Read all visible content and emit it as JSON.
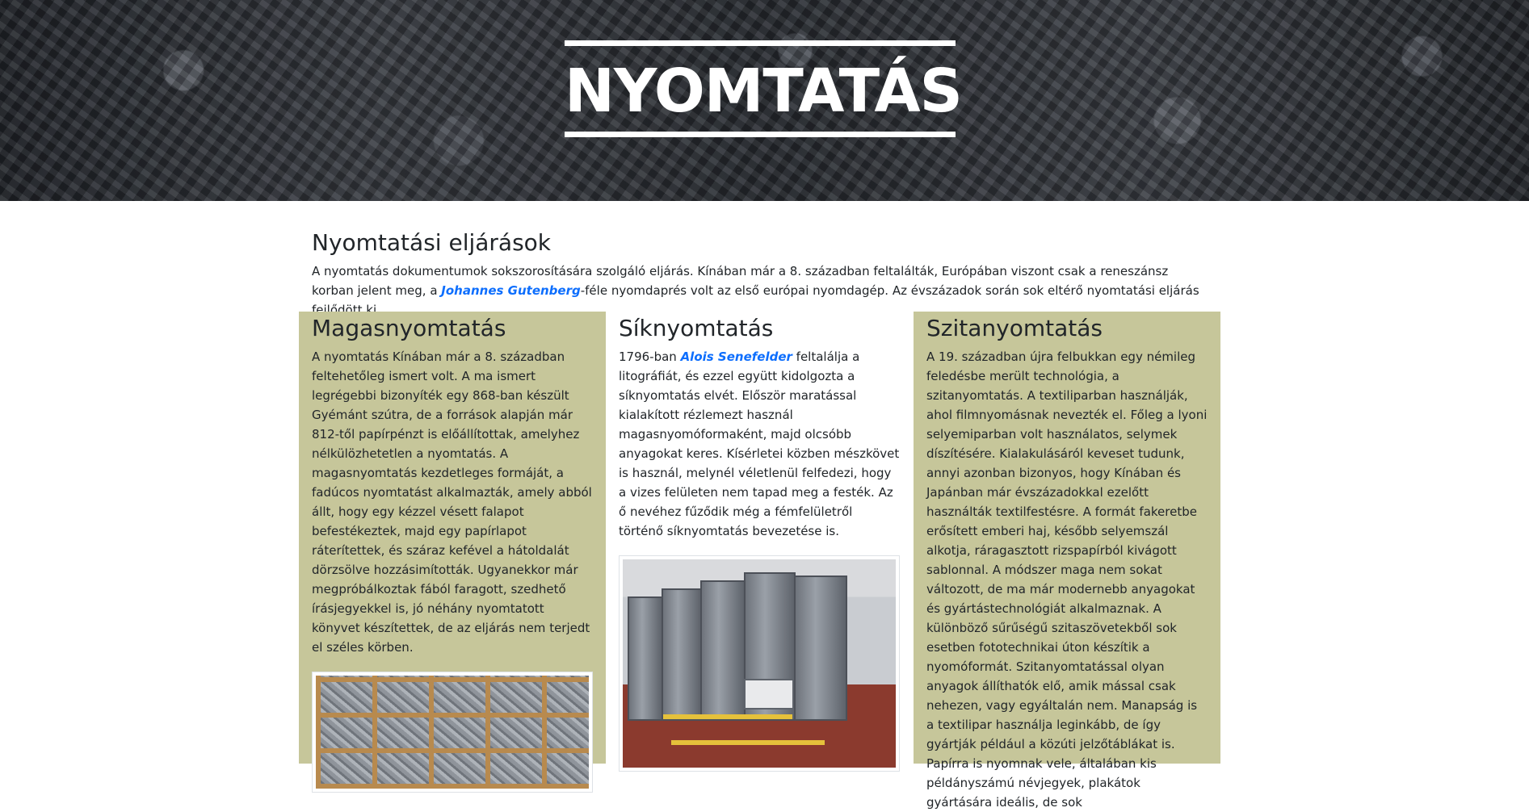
{
  "hero": {
    "title": "NYOMTATÁS"
  },
  "intro": {
    "heading": "Nyomtatási eljárások",
    "text_before_link": "A nyomtatás dokumentumok sokszorosítására szolgáló eljárás. Kínában már a 8. században feltalálták, Európában viszont csak a reneszánsz korban jelent meg, a ",
    "link": "Johannes Gutenberg",
    "text_after_link": "-féle nyomdaprés volt az első európai nyomdagép. Az évszázadok során sok eltérő nyomtatási eljárás fejlődött ki."
  },
  "columns": [
    {
      "heading": "Magasnyomtatás",
      "text": "A nyomtatás Kínában már a 8. században feltehetőleg ismert volt. A ma ismert legrégebbi bizonyíték egy 868-ban készült Gyémánt szútra, de a források alapján már 812-től papírpénzt is előállítottak, amelyhez nélkülözhetetlen a nyomtatás. A magasnyomtatás kezdetleges formáját, a fadúcos nyomtatást alkalmazták, amely abból állt, hogy egy kézzel vésett falapot befestékeztek, majd egy papírlapot ráterítettek, és száraz kefével a hátoldalát dörzsölve hozzásimították. Ugyanekkor már megpróbálkoztak fából faragott, szedhető írásjegyekkel is, jó néhány nyomtatott könyvet készítettek, de az eljárás nem terjedt el széles körben."
    },
    {
      "heading": "Síknyomtatás",
      "text_before_link": "1796-ban ",
      "link": "Alois Senefelder",
      "text_after_link": " feltalálja a litográfiát, és ezzel együtt kidolgozta a síknyomtatás elvét. Először maratással kialakított rézlemezt használ magasnyomóformaként, majd olcsóbb anyagokat keres. Kísérletei közben mészkövet is használ, melynél véletlenül felfedezi, hogy a vizes felületen nem tapad meg a festék. Az ő nevéhez fűződik még a fémfelületről történő síknyomtatás bevezetése is."
    },
    {
      "heading": "Szitanyomtatás",
      "text": "A 19. században újra felbukkan egy némileg feledésbe merült technológia, a szitanyomtatás. A textiliparban használják, ahol filmnyomásnak nevezték el. Főleg a lyoni selyemiparban volt használatos, selymek díszítésére. Kialakulásáról keveset tudunk, annyi azonban bizonyos, hogy Kínában és Japánban már évszázadokkal ezelőtt használták textilfestésre. A formát fakeretbe erősített emberi haj, később selyemszál alkotja, ráragasztott rizspapírból kivágott sablonnal. A módszer maga nem sokat változott, de ma már modernebb anyagokat és gyártástechnológiát alkalmaznak. A különböző sűrűségű szitaszövetekből sok esetben fototechnikai úton készítik a nyomóformát. Szitanyomtatással olyan anyagok állíthatók elő, amik mással csak nehezen, vagy egyáltalán nem. Manapság is a textilipar használja leginkább, de így gyártják például a közúti jelzőtáblákat is. Papírra is nyomnak vele, általában kis példányszámú névjegyek, plakátok gyártására ideális, de sok"
    }
  ]
}
